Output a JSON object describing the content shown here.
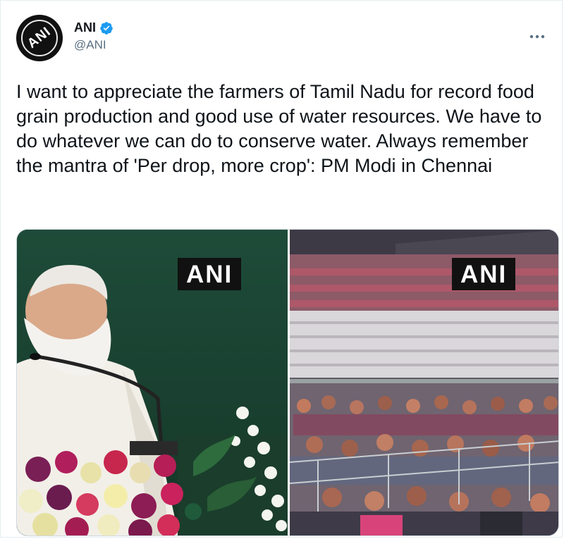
{
  "tweet": {
    "author": {
      "display_name": "ANI",
      "handle": "@ANI",
      "verified": true,
      "avatar_logo_text": "ANI"
    },
    "more_icon": "more-horizontal-icon",
    "text": "I want to appreciate the farmers of Tamil Nadu for record food grain production and good use of water resources. We have to do whatever we can do to conserve water. Always remember the mantra of 'Per drop, more crop': PM Modi in Chennai",
    "media": [
      {
        "watermark": "ANI",
        "description": "speaker-at-podium"
      },
      {
        "watermark": "ANI",
        "description": "audience-in-stadium"
      }
    ]
  },
  "colors": {
    "verified_blue": "#1d9bf0",
    "secondary_text": "#5b7083",
    "border": "#e6ecf0"
  }
}
